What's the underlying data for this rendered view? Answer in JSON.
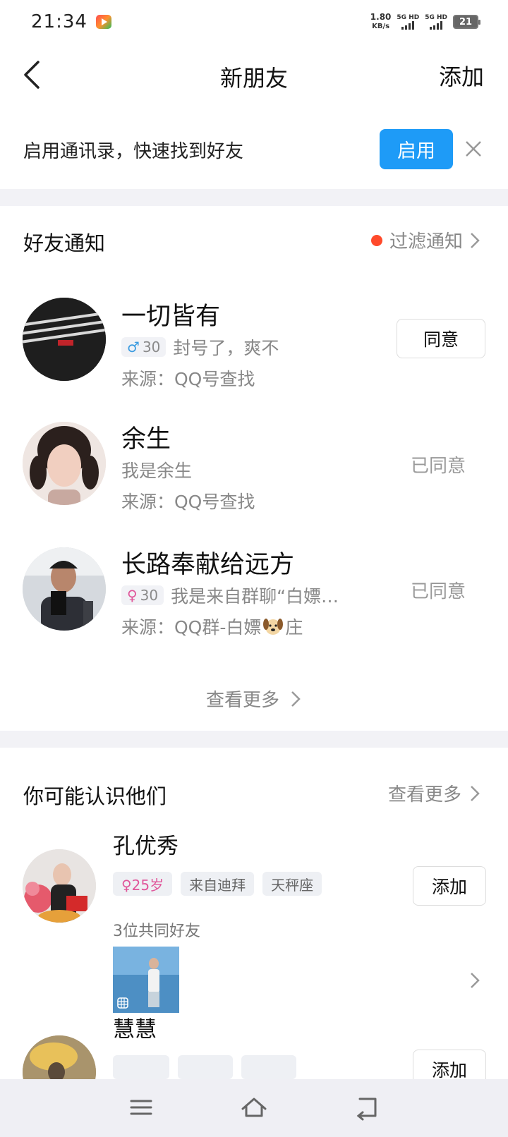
{
  "status": {
    "time": "21:34",
    "net_speed_value": "1.80",
    "net_speed_unit": "KB/s",
    "sim1": "5G HD",
    "sim2": "5G HD",
    "battery": "21"
  },
  "header": {
    "title": "新朋友",
    "add_label": "添加"
  },
  "banner": {
    "text": "启用通讯录，快速找到好友",
    "enable_label": "启用"
  },
  "notifications": {
    "title": "好友通知",
    "filter_label": "过滤通知",
    "requests": [
      {
        "name": "一切皆有",
        "gender": "♂",
        "age": "30",
        "message": "封号了，爽不",
        "source": "来源：QQ号查找",
        "action": "同意"
      },
      {
        "name": "余生",
        "message": "我是余生",
        "source": "来源：QQ号查找",
        "status": "已同意"
      },
      {
        "name": "长路奉献给远方",
        "gender": "♀",
        "age": "30",
        "message": "我是来自群聊“白嫖…",
        "source": "来源：QQ群-白嫖",
        "source_suffix": "庄",
        "status": "已同意"
      }
    ],
    "see_more": "查看更多"
  },
  "suggestions": {
    "title": "你可能认识他们",
    "see_more": "查看更多",
    "people": [
      {
        "name": "孔优秀",
        "tags": [
          "♀25岁",
          "来自迪拜",
          "天秤座"
        ],
        "mutual": "3位共同好友",
        "action": "添加"
      },
      {
        "name": "慧慧",
        "action": "添加"
      }
    ]
  },
  "colors": {
    "accent": "#1e9bf7",
    "dot": "#ff4a2b",
    "male": "#3a9be0",
    "female": "#e0569a"
  }
}
